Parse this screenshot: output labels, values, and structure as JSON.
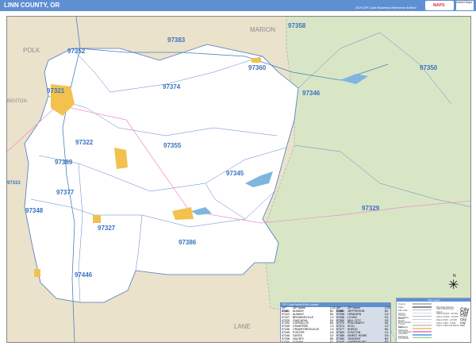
{
  "header": {
    "title": "LINN COUNTY, OR",
    "edition": "2020 ZIP Code Business Reference Edition",
    "logo": "MAPS",
    "publisher": "Market Maps"
  },
  "map": {
    "colors": {
      "county": "#ffffff",
      "forest": "#d9e6c6",
      "outside": "#ebe2cc",
      "zip_label": "#3a72bf",
      "water": "#7fb6dd",
      "city": "#f2c14e"
    },
    "county_labels": [
      {
        "name": "POLK"
      },
      {
        "name": "MARION"
      },
      {
        "name": "BENTON"
      },
      {
        "name": "LANE"
      }
    ],
    "zip_labels": [
      "97352",
      "97383",
      "97358",
      "97360",
      "97350",
      "97321",
      "97374",
      "97346",
      "97322",
      "97355",
      "97389",
      "97333",
      "97345",
      "97329",
      "97377",
      "97348",
      "97327",
      "97386",
      "97446"
    ]
  },
  "index": {
    "title": "ZIP Code Index/Grid Locator",
    "headers": [
      "ZIP Code",
      "ZIP Name",
      "LOC"
    ],
    "left": [
      [
        "97321",
        "ALBANY",
        "B3"
      ],
      [
        "97322",
        "ALBANY",
        "B3"
      ],
      [
        "97327",
        "BROWNSVILLE",
        "C3"
      ],
      [
        "97329",
        "CASCADIA",
        "E4"
      ],
      [
        "97330",
        "CORVALLIS",
        "B4"
      ],
      [
        "97335",
        "CRABTREE",
        "C3"
      ],
      [
        "97336",
        "CRAWFORDSVILLE",
        "C3"
      ],
      [
        "97345",
        "FOSTER",
        "D4"
      ],
      [
        "97346",
        "GATES",
        "D2"
      ],
      [
        "97348",
        "HALSEY",
        "B5"
      ],
      [
        "97350",
        "IDANHA",
        "F2"
      ]
    ],
    "right": [
      [
        "97352",
        "JEFFERSON",
        "B2"
      ],
      [
        "97355",
        "LEBANON",
        "C4"
      ],
      [
        "97358",
        "LYONS",
        "D1"
      ],
      [
        "97360",
        "MILL CITY",
        "D2"
      ],
      [
        "97370",
        "PHILOMATH",
        "A4"
      ],
      [
        "97374",
        "SCIO",
        "C2"
      ],
      [
        "97377",
        "SHEDD",
        "B4"
      ],
      [
        "97383",
        "STAYTON",
        "C1"
      ],
      [
        "97386",
        "SWEET HOME",
        "D4"
      ],
      [
        "97389",
        "TANGENT",
        "B4"
      ],
      [
        "97446",
        "HARRISBURG",
        "B5"
      ]
    ]
  },
  "legend": {
    "title": "Map Legend",
    "items": [
      "County",
      "State",
      "ZIP Code",
      "Streets",
      "Primary Roads",
      "Secondary Roads",
      "Minor Roads",
      "County Highways",
      "State Highways",
      "US Highways",
      "Interstate Highways",
      "Toll Roads"
    ],
    "swatches": [
      "#bbbbbb",
      "#888888",
      "#9fc0e0",
      "#dddddd",
      "#bbbbbb",
      "#cccccc",
      "#e6e6e6",
      "#cfcfcf",
      "#f5c98a",
      "#f08fc8",
      "#6fb3e8",
      "#7bd36b"
    ],
    "places_title": "Populated Places",
    "places": [
      "Cities 50,000 and Above",
      "Cities 25,000 - 50,000",
      "Cities 10,000 - 25,000",
      "Cities 5,000 - 10,000",
      "Cities 1,000 - 5,000",
      "Cities 1,000 and Below"
    ],
    "place_samples": [
      "City",
      "City",
      "City",
      "City",
      "City",
      "City"
    ]
  },
  "compass": {
    "label": "N"
  }
}
